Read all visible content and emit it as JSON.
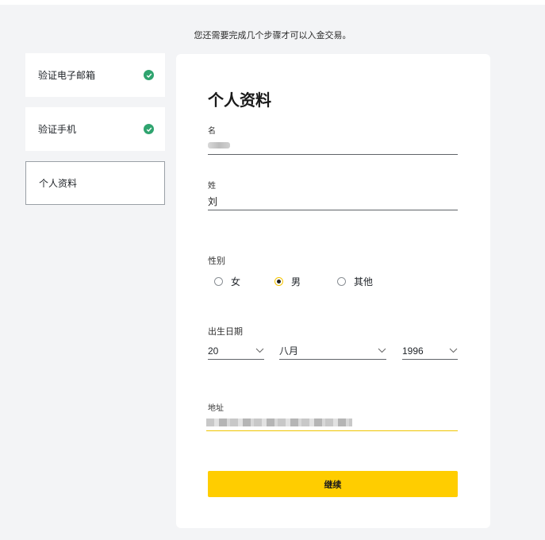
{
  "notice": "您还需要完成几个步骤才可以入金交易。",
  "steps": [
    {
      "label": "验证电子邮箱",
      "done": true
    },
    {
      "label": "验证手机",
      "done": true
    },
    {
      "label": "个人资料",
      "done": false
    }
  ],
  "form": {
    "title": "个人资料",
    "first_name": {
      "label": "名",
      "value": ""
    },
    "last_name": {
      "label": "姓",
      "value": "刘"
    },
    "gender": {
      "label": "性别",
      "options": [
        "女",
        "男",
        "其他"
      ],
      "selected": "男"
    },
    "dob": {
      "label": "出生日期",
      "day": "20",
      "month": "八月",
      "year": "1996"
    },
    "address": {
      "label": "地址",
      "value": ""
    },
    "continue_label": "继续"
  },
  "colors": {
    "accent": "#ffcd00",
    "check": "#2fa46f"
  }
}
